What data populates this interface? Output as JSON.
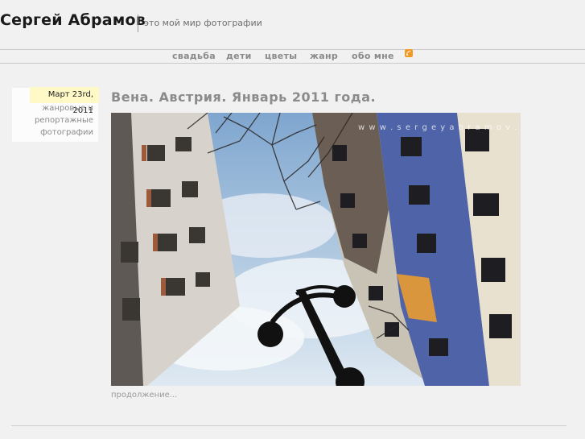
{
  "site": {
    "title": "Сергей Абрамов",
    "tagline": "это мой мир фотографии"
  },
  "nav": {
    "items": [
      "свадьба",
      "дети",
      "цветы",
      "жанр",
      "обо мне"
    ],
    "rss_icon": "rss-icon"
  },
  "post": {
    "date": "Март 23rd, 2011",
    "categories": [
      "жанровые и",
      "репортажные",
      "фотографии"
    ],
    "title": "Вена. Австрия. Январь 2011 года.",
    "watermark": "w w w . s e r g e y a b r a m o v . c o m",
    "more_link": "продолжение..."
  },
  "colors": {
    "background": "#f1f1f1",
    "date_highlight": "#fff8c7",
    "nav_text": "#8a8a8a",
    "rss": "#f39a25"
  }
}
